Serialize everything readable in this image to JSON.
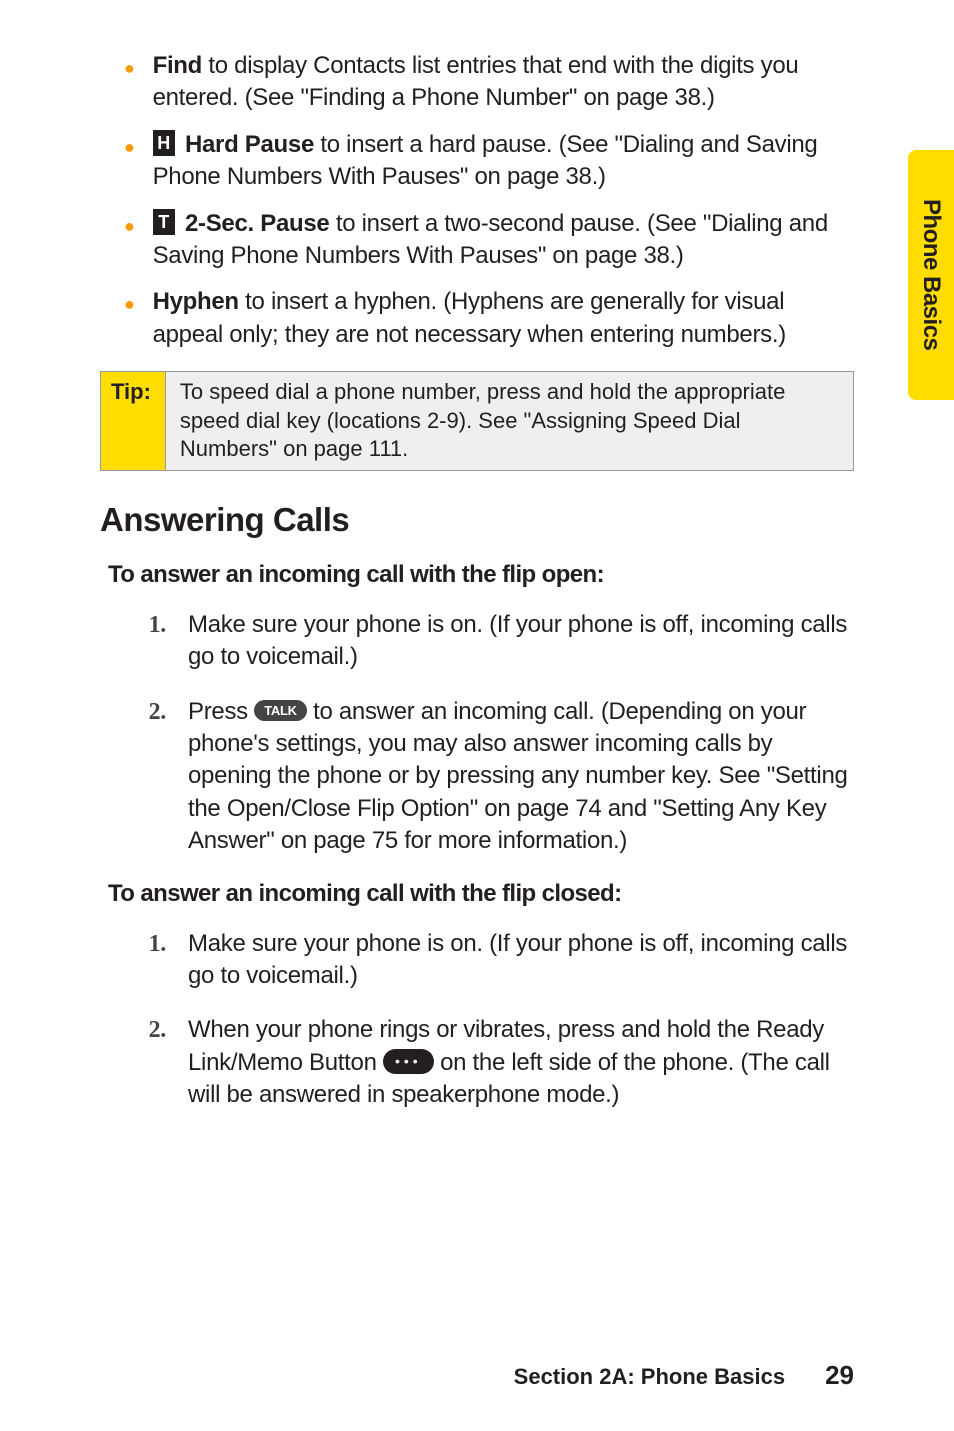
{
  "sideTab": "Phone Basics",
  "bullets": [
    {
      "bold": "Find",
      "text": " to display Contacts list entries that end with the digits you entered. (See \"Finding a Phone Number\" on page 38.)"
    },
    {
      "icon": "H",
      "bold": "Hard Pause",
      "text": " to insert a hard pause. (See \"Dialing and Saving Phone Numbers With Pauses\" on page 38.)"
    },
    {
      "icon": "T",
      "bold": "2-Sec. Pause",
      "text": " to insert a two-second pause. (See \"Dialing and Saving Phone Numbers With Pauses\" on page 38.)"
    },
    {
      "bold": "Hyphen",
      "text": " to insert a hyphen. (Hyphens are generally for visual appeal only; they are not necessary when entering numbers.)"
    }
  ],
  "tip": {
    "label": "Tip:",
    "content": "To speed dial a phone number, press and hold the appropriate speed dial key (locations 2-9). See \"Assigning Speed Dial Numbers\" on page 111."
  },
  "heading": "Answering Calls",
  "sub1": "To answer an incoming call with the flip open:",
  "steps1": [
    {
      "num": "1.",
      "text": "Make sure your phone is on. (If your phone is off, incoming calls go to voicemail.)"
    },
    {
      "num": "2.",
      "pre": "Press ",
      "pill": "TALK",
      "post": " to answer an incoming call. (Depending on your phone's settings, you may also answer incoming calls by opening the phone or by pressing any number key. See \"Setting the Open/Close Flip Option\" on page 74 and \"Setting Any Key Answer\" on page 75 for more information.)"
    }
  ],
  "sub2": "To answer an incoming call with the flip closed:",
  "steps2": [
    {
      "num": "1.",
      "text": "Make sure your phone is on. (If your phone is off, incoming calls go to voicemail.)"
    },
    {
      "num": "2.",
      "pre": "When your phone rings or vibrates, press and hold the Ready Link/Memo Button ",
      "pill": "•••",
      "post": " on the left side of the phone. (The call will be answered in speakerphone mode.)"
    }
  ],
  "footer": {
    "section": "Section 2A: Phone Basics",
    "page": "29"
  }
}
